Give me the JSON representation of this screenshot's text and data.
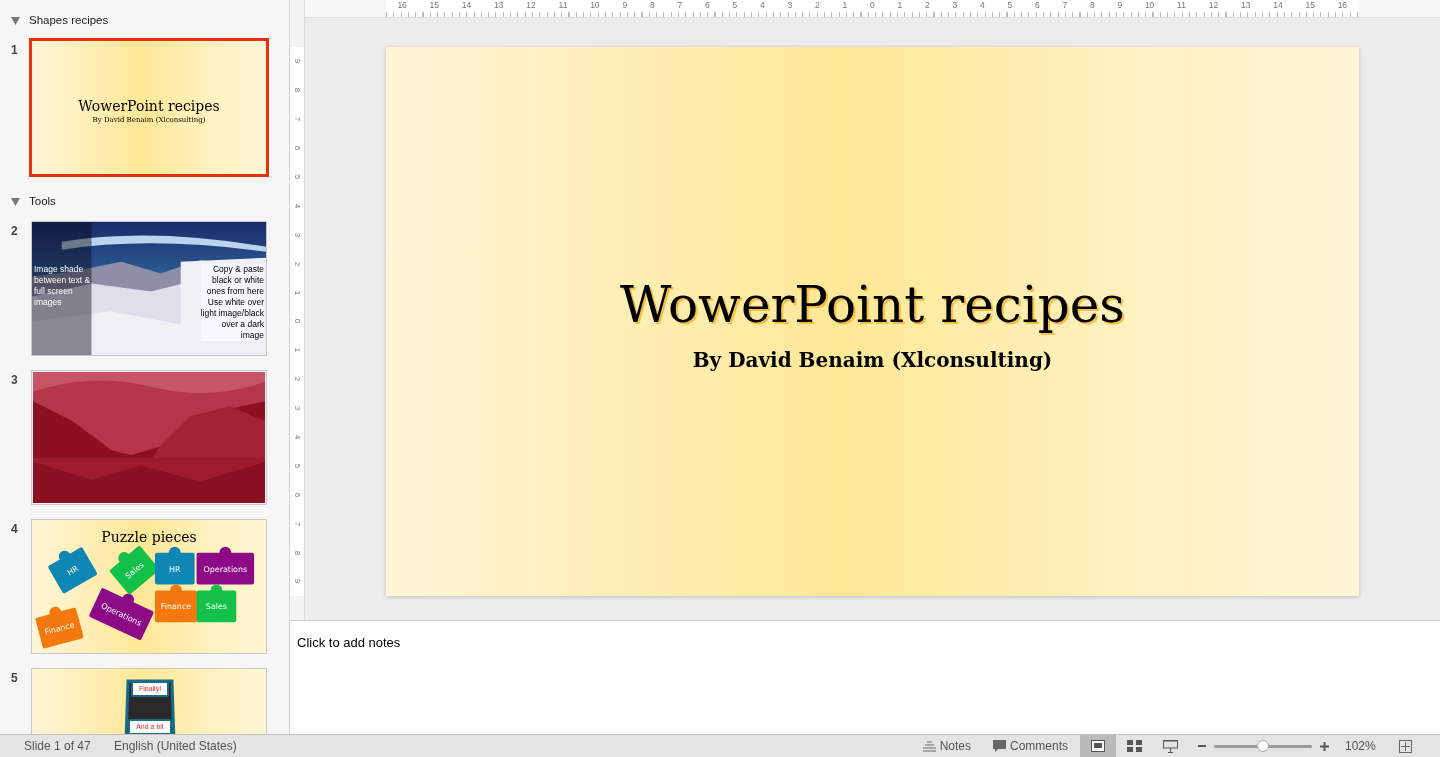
{
  "sidebar": {
    "sections": [
      {
        "title": "Shapes recipes",
        "expanded": true,
        "slides": [
          {
            "number": "1",
            "selected": true,
            "kind": "title",
            "title": "WowerPoint recipes",
            "subtitle": "By David Benaim (Xlconsulting)"
          }
        ]
      },
      {
        "title": "Tools",
        "expanded": true,
        "slides": [
          {
            "number": "2",
            "selected": false,
            "kind": "photo_text",
            "left_lines": [
              "Image shade",
              "between text &",
              "full screen",
              "images"
            ],
            "right_lines": [
              "Copy & paste",
              "black or white",
              "ones from here",
              "Use white over",
              "light image/black",
              "over a dark",
              "image"
            ]
          },
          {
            "number": "3",
            "selected": false
          },
          {
            "number": "4",
            "selected": false,
            "kind": "puzzle",
            "title": "Puzzle pieces",
            "pieces": [
              {
                "label": "HR",
                "color": "#0e87b4"
              },
              {
                "label": "Sales",
                "color": "#12c04a"
              },
              {
                "label": "Finance",
                "color": "#f5780f"
              },
              {
                "label": "Operations",
                "color": "#8d0a86"
              },
              {
                "label": "HR",
                "color": "#0e87b4"
              },
              {
                "label": "Operations",
                "color": "#8d0a86"
              },
              {
                "label": "Finance",
                "color": "#f5780f"
              },
              {
                "label": "Sales",
                "color": "#12c04a"
              }
            ]
          },
          {
            "number": "5",
            "selected": false,
            "kind": "road",
            "signs": [
              "Finally!",
              "And a bit"
            ]
          }
        ]
      }
    ]
  },
  "rulers": {
    "horizontal": [
      "16",
      "15",
      "14",
      "13",
      "12",
      "11",
      "10",
      "9",
      "8",
      "7",
      "6",
      "5",
      "4",
      "3",
      "2",
      "1",
      "0",
      "1",
      "2",
      "3",
      "4",
      "5",
      "6",
      "7",
      "8",
      "9",
      "10",
      "11",
      "12",
      "13",
      "14",
      "15",
      "16"
    ],
    "vertical": [
      "9",
      "8",
      "7",
      "6",
      "5",
      "4",
      "3",
      "2",
      "1",
      "0",
      "1",
      "2",
      "3",
      "4",
      "5",
      "6",
      "7",
      "8",
      "9"
    ]
  },
  "slide": {
    "title": "WowerPoint recipes",
    "subtitle": "By David Benaim (Xlconsulting)"
  },
  "notes": {
    "placeholder": "Click to add notes"
  },
  "status_bar": {
    "slide_count": "Slide 1 of 47",
    "language": "English (United States)",
    "notes_button": "Notes",
    "comments_button": "Comments",
    "views": [
      {
        "kind": "normal",
        "selected": true
      },
      {
        "kind": "sorter",
        "selected": false
      },
      {
        "kind": "presenter",
        "selected": false
      }
    ],
    "zoom": {
      "level": 0.5,
      "reading": "102%"
    }
  }
}
